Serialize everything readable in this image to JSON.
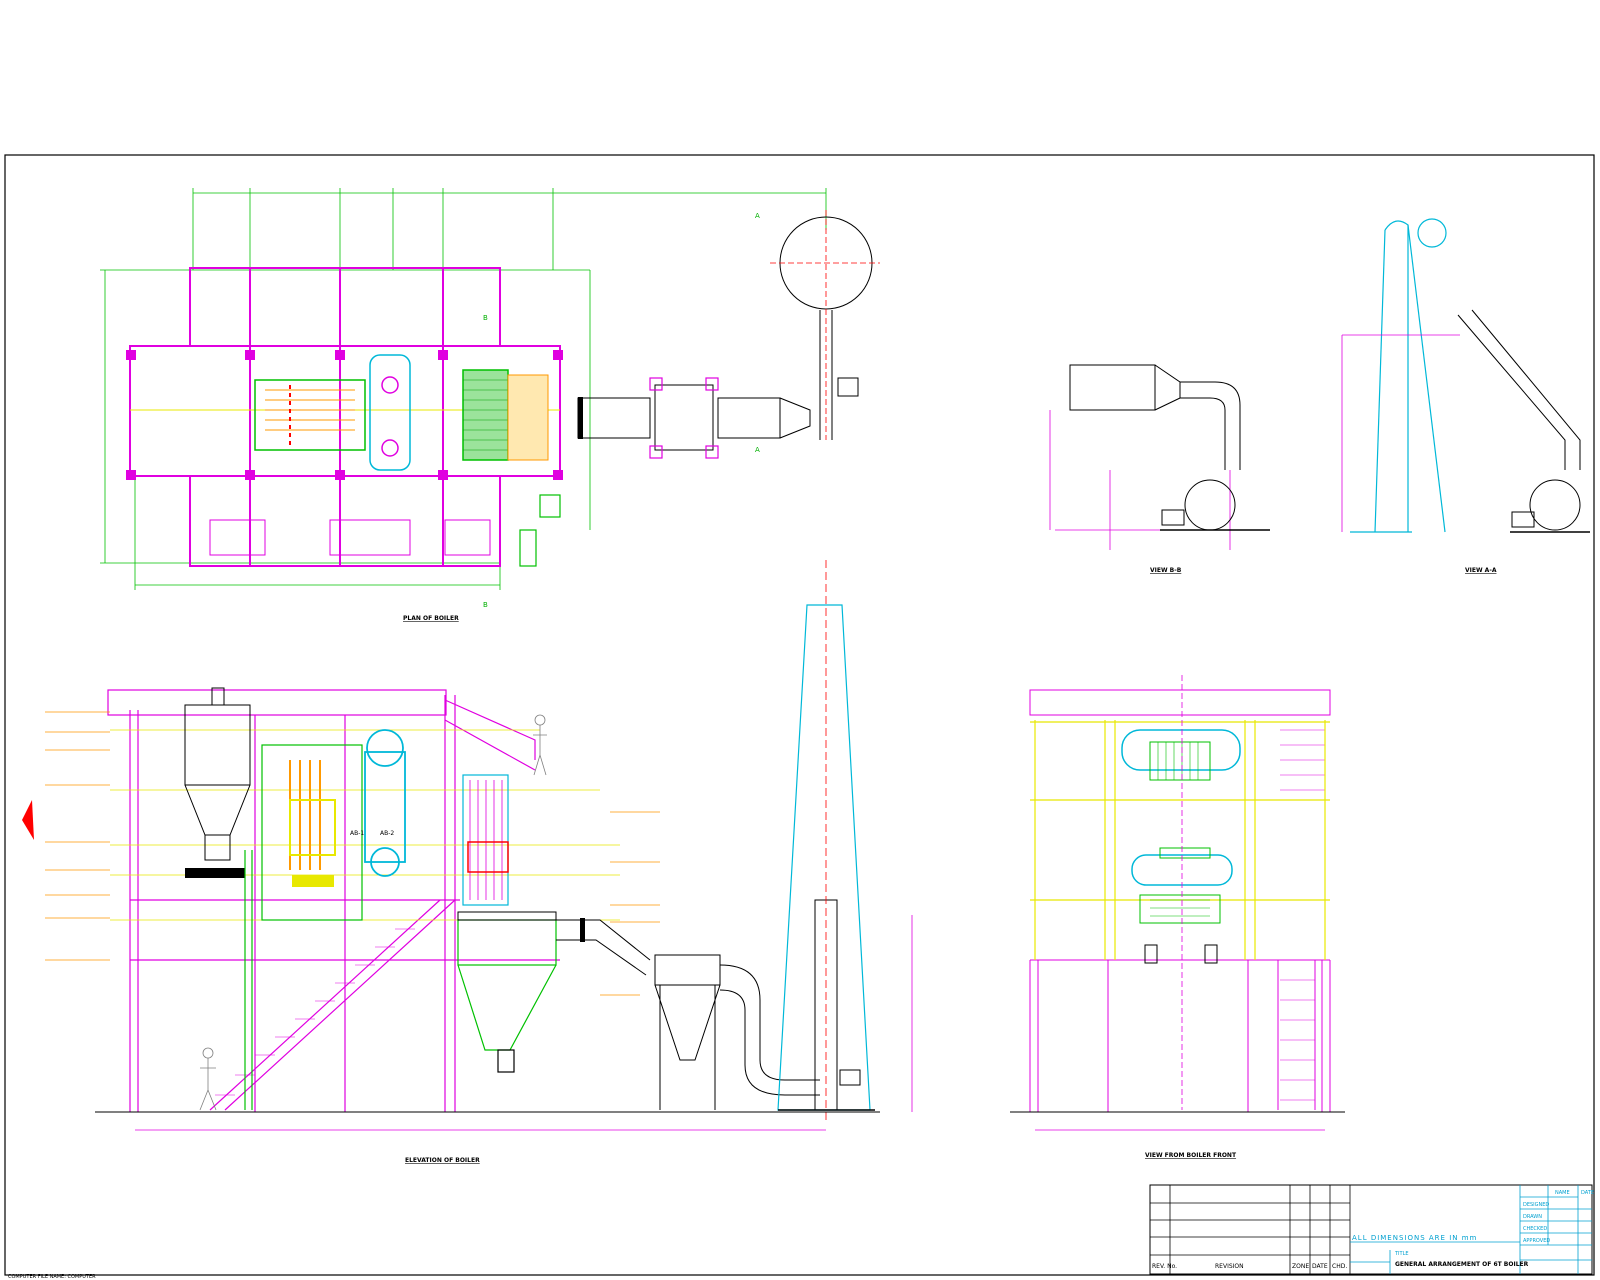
{
  "drawing": {
    "views": {
      "plan": "PLAN OF BOILER",
      "elevation": "ELEVATION OF BOILER",
      "front": "VIEW FROM BOILER FRONT",
      "view_b": "VIEW B-B",
      "view_a": "VIEW A-A"
    },
    "section_marks": {
      "a": "A",
      "b": "B"
    },
    "drum_labels": {
      "d1": "AB-1",
      "d2": "AB-2"
    }
  },
  "title_block": {
    "dimensions_note": "ALL DIMENSIONS ARE IN mm",
    "title_label": "TITLE",
    "title": "GENERAL ARRANGEMENT OF 6T BOILER",
    "headers": {
      "rev_no": "REV. No.",
      "revision": "REVISION",
      "zone": "ZONE",
      "date": "DATE",
      "chd": "CHD."
    },
    "signatures": [
      "DESIGNED",
      "DRAWN",
      "CHECKED",
      "APPROVED"
    ],
    "columns": {
      "name": "NAME",
      "date": "DATE"
    }
  },
  "footer": {
    "file_name": "COMPUTER FILE NAME: COMPUTER"
  },
  "colors": {
    "structure": "#e000e0",
    "grid": "#00c000",
    "boiler": "#00b8d8",
    "frame": "#e8e800",
    "dim": "#ff9900",
    "accent": "#ff0000",
    "outline": "#000000"
  }
}
